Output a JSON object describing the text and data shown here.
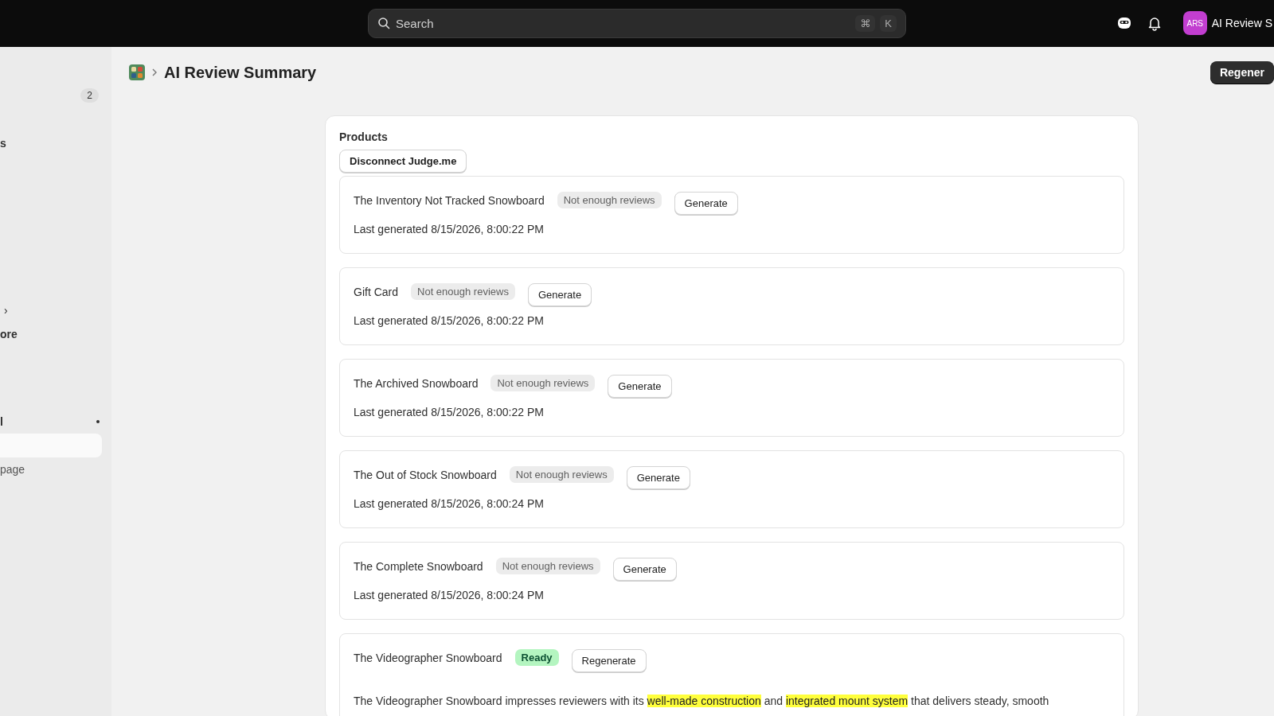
{
  "topbar": {
    "search": {
      "placeholder": "Search",
      "shortcut": [
        "⌘",
        "K"
      ]
    },
    "avatar_initials": "ARS",
    "store_name": "AI Review S"
  },
  "sidebar": {
    "items": [
      {
        "kind": "badge",
        "label": "2",
        "selected": false
      },
      {
        "kind": "text",
        "label": "s",
        "selected": false
      },
      {
        "kind": "chevron",
        "label": "›",
        "selected": false
      },
      {
        "kind": "text",
        "label": "ore",
        "selected": false
      },
      {
        "kind": "dot",
        "label": "l",
        "selected": false
      },
      {
        "kind": "blank",
        "selected": true
      },
      {
        "kind": "muted",
        "label": "page",
        "selected": false
      }
    ]
  },
  "header": {
    "title": "AI Review Summary",
    "action": "Regener"
  },
  "card": {
    "title": "Products",
    "disconnect": "Disconnect Judge.me",
    "products": [
      {
        "name": "The Inventory Not Tracked Snowboard",
        "status": "Not enough reviews",
        "ready": false,
        "action": "Generate",
        "last": "Last generated 8/15/2026, 8:00:22 PM"
      },
      {
        "name": "Gift Card",
        "status": "Not enough reviews",
        "ready": false,
        "action": "Generate",
        "last": "Last generated 8/15/2026, 8:00:22 PM"
      },
      {
        "name": "The Archived Snowboard",
        "status": "Not enough reviews",
        "ready": false,
        "action": "Generate",
        "last": "Last generated 8/15/2026, 8:00:22 PM"
      },
      {
        "name": "The Out of Stock Snowboard",
        "status": "Not enough reviews",
        "ready": false,
        "action": "Generate",
        "last": "Last generated 8/15/2026, 8:00:24 PM"
      },
      {
        "name": "The Complete Snowboard",
        "status": "Not enough reviews",
        "ready": false,
        "action": "Generate",
        "last": "Last generated 8/15/2026, 8:00:24 PM"
      },
      {
        "name": "The Videographer Snowboard",
        "status": "Ready",
        "ready": true,
        "action": "Regenerate",
        "summary": [
          {
            "text": "The Videographer Snowboard impresses reviewers with its ",
            "highlight": false
          },
          {
            "text": "well-made construction",
            "highlight": true
          },
          {
            "text": " and ",
            "highlight": false
          },
          {
            "text": "integrated mount system",
            "highlight": true
          },
          {
            "text": " that delivers steady, smooth",
            "highlight": false
          }
        ]
      }
    ]
  }
}
